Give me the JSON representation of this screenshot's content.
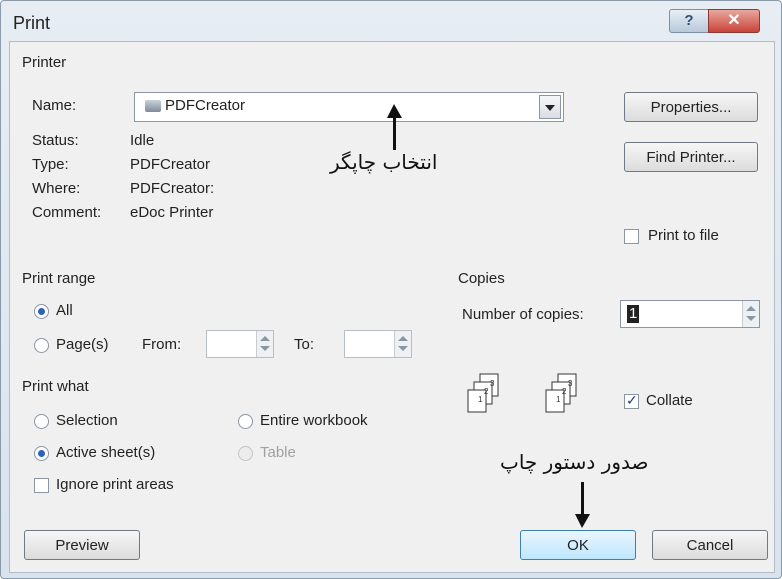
{
  "window": {
    "title": "Print",
    "help": "?",
    "close": "✕"
  },
  "printer": {
    "section_label": "Printer",
    "name_label": "Name:",
    "name_value": "PDFCreator",
    "status_label": "Status:",
    "status_value": "Idle",
    "type_label": "Type:",
    "type_value": "PDFCreator",
    "where_label": "Where:",
    "where_value": "PDFCreator:",
    "comment_label": "Comment:",
    "comment_value": "eDoc Printer",
    "properties_button": "Properties...",
    "find_printer_button": "Find Printer...",
    "print_to_file_label": "Print to file",
    "print_to_file_checked": false
  },
  "print_range": {
    "section_label": "Print range",
    "all_label": "All",
    "pages_label": "Page(s)",
    "from_label": "From:",
    "to_label": "To:",
    "from_value": "",
    "to_value": "",
    "selected": "All"
  },
  "print_what": {
    "section_label": "Print what",
    "selection_label": "Selection",
    "entire_workbook_label": "Entire workbook",
    "active_sheets_label": "Active sheet(s)",
    "table_label": "Table",
    "ignore_print_areas_label": "Ignore print areas",
    "selected": "Active sheet(s)"
  },
  "copies": {
    "section_label": "Copies",
    "number_label": "Number of copies:",
    "number_value": "1",
    "collate_label": "Collate",
    "collate_checked": true
  },
  "annotations": {
    "select_printer": "انتخاب چاپگر",
    "issue_print": "صدور دستور چاپ"
  },
  "buttons": {
    "preview": "Preview",
    "ok": "OK",
    "cancel": "Cancel"
  }
}
